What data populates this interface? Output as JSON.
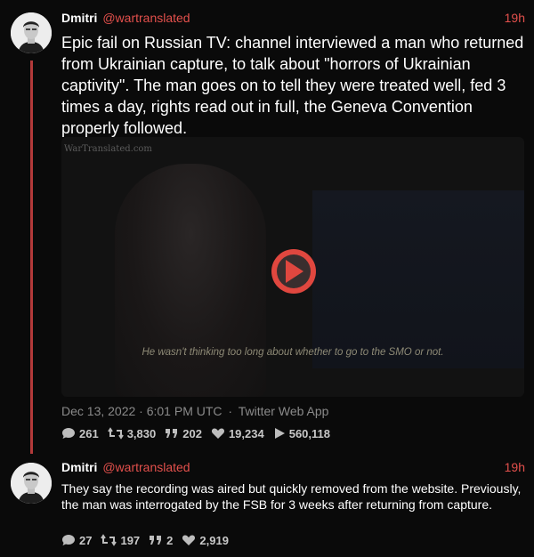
{
  "tweets": [
    {
      "author": "Dmitri",
      "handle": "@wartranslated",
      "time": "19h",
      "text": "Epic fail on Russian TV: channel interviewed a man who returned from Ukrainian capture, to talk about \"horrors of Ukrainian captivity\". The man goes on to tell they were treated well, fed 3 times a day, rights read out in full, the Geneva Convention properly followed.",
      "video": {
        "watermark": "WarTranslated.com",
        "subtitle": "He wasn't thinking too long about whether to go to the SMO or not."
      },
      "date": "Dec 13, 2022 · 6:01 PM UTC",
      "separator": "·",
      "client": "Twitter Web App",
      "stats": {
        "replies": "261",
        "retweets": "3,830",
        "quotes": "202",
        "likes": "19,234",
        "views": "560,118"
      }
    },
    {
      "author": "Dmitri",
      "handle": "@wartranslated",
      "time": "19h",
      "text": "They say the recording was aired but quickly removed from the website. Previously, the man was interrogated by the FSB for 3 weeks after returning from capture.",
      "stats": {
        "replies": "27",
        "retweets": "197",
        "quotes": "2",
        "likes": "2,919"
      }
    }
  ],
  "icons": [
    "reply-icon",
    "retweet-icon",
    "quote-icon",
    "like-icon",
    "views-icon",
    "play-icon"
  ],
  "colors": {
    "accent": "#e3504c",
    "thread": "#b33a3a",
    "background": "#0a0a0a"
  }
}
